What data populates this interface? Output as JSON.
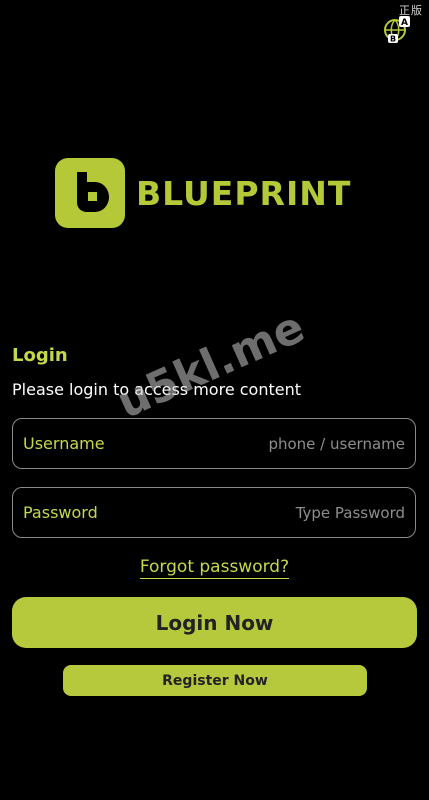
{
  "corner": {
    "text": "正版",
    "icon": "translate-icon"
  },
  "logo": {
    "wordmark": "BLUEPRINT",
    "icon": "blueprint-logo-icon"
  },
  "login": {
    "title": "Login",
    "subtitle": "Please login to access more content"
  },
  "username": {
    "label": "Username",
    "placeholder": "phone / username",
    "value": ""
  },
  "password": {
    "label": "Password",
    "placeholder": "Type Password",
    "value": ""
  },
  "forgot": {
    "label": "Forgot password?"
  },
  "buttons": {
    "login_label": "Login Now",
    "register_label": "Register Now"
  },
  "watermark": {
    "text": "u5kl.me"
  },
  "colors": {
    "background": "#000000",
    "accent": "#b6c83c",
    "accent_text": "#c6d84a",
    "button_text": "#222222",
    "field_border": "#8a8a8a",
    "placeholder": "#8e8e8e"
  }
}
